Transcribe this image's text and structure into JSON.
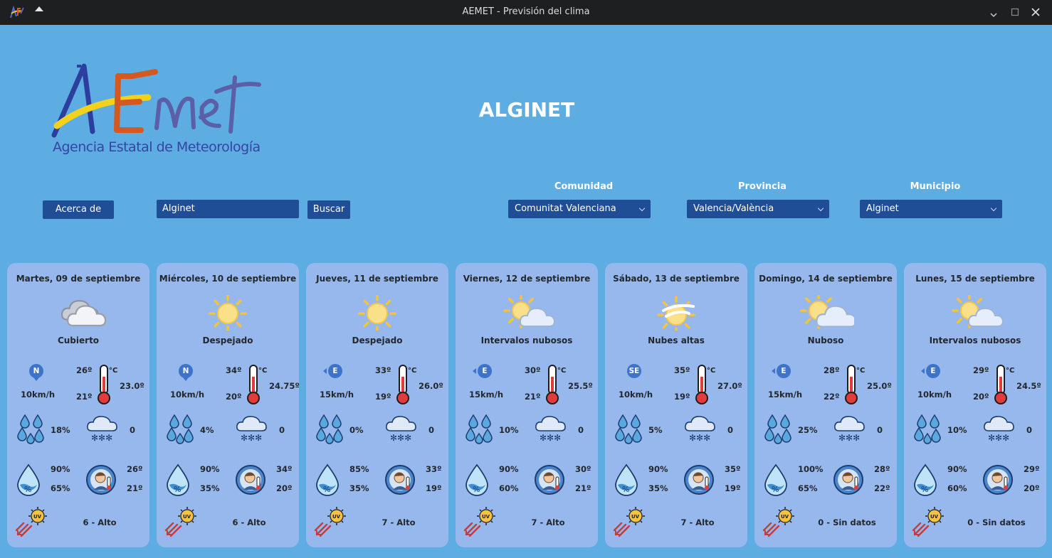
{
  "window": {
    "title": "AEMET - Previsión del clima"
  },
  "logo": {
    "subtitle": "Agencia Estatal de Meteorología"
  },
  "header": {
    "city": "ALGINET"
  },
  "controls": {
    "about_label": "Acerca de",
    "search_value": "Alginet",
    "search_button": "Buscar",
    "comunidad_label": "Comunidad",
    "comunidad_value": "Comunitat Valenciana",
    "provincia_label": "Provincia",
    "provincia_value": "Valencia/València",
    "municipio_label": "Municipio",
    "municipio_value": "Alginet"
  },
  "colors": {
    "background": "#5dade2",
    "card": "#96b8ec",
    "control": "#1f4e96",
    "titlebar": "#1d1f20"
  },
  "days": [
    {
      "date": "Martes, 09 de septiembre",
      "sky_icon": "cloudy-icon",
      "sky": "Cubierto",
      "wind_dir": "N",
      "wind_arrow": "down",
      "wind_speed": "10km/h",
      "t_max": "26º",
      "t_min": "21º",
      "t_avg": "23.0º",
      "rain_prob": "18%",
      "snow": "0",
      "hum_max": "90%",
      "hum_min": "65%",
      "feel_max": "26º",
      "feel_min": "21º",
      "uv": "6 - Alto"
    },
    {
      "date": "Miércoles, 10 de septiembre",
      "sky_icon": "sun-icon",
      "sky": "Despejado",
      "wind_dir": "N",
      "wind_arrow": "down",
      "wind_speed": "10km/h",
      "t_max": "34º",
      "t_min": "20º",
      "t_avg": "24.75º",
      "rain_prob": "4%",
      "snow": "0",
      "hum_max": "90%",
      "hum_min": "35%",
      "feel_max": "34º",
      "feel_min": "20º",
      "uv": "6 - Alto"
    },
    {
      "date": "Jueves, 11 de septiembre",
      "sky_icon": "sun-icon",
      "sky": "Despejado",
      "wind_dir": "E",
      "wind_arrow": "left",
      "wind_speed": "15km/h",
      "t_max": "33º",
      "t_min": "19º",
      "t_avg": "26.0º",
      "rain_prob": "0%",
      "snow": "0",
      "hum_max": "85%",
      "hum_min": "35%",
      "feel_max": "33º",
      "feel_min": "19º",
      "uv": "7 - Alto"
    },
    {
      "date": "Viernes, 12 de septiembre",
      "sky_icon": "sun-cloud-icon",
      "sky": "Intervalos nubosos",
      "wind_dir": "E",
      "wind_arrow": "left",
      "wind_speed": "15km/h",
      "t_max": "30º",
      "t_min": "21º",
      "t_avg": "25.5º",
      "rain_prob": "10%",
      "snow": "0",
      "hum_max": "90%",
      "hum_min": "60%",
      "feel_max": "30º",
      "feel_min": "21º",
      "uv": "7 - Alto"
    },
    {
      "date": "Sábado, 13 de septiembre",
      "sky_icon": "sun-high-clouds-icon",
      "sky": "Nubes altas",
      "wind_dir": "SE",
      "wind_arrow": "none",
      "wind_speed": "10km/h",
      "t_max": "35º",
      "t_min": "19º",
      "t_avg": "27.0º",
      "rain_prob": "5%",
      "snow": "0",
      "hum_max": "90%",
      "hum_min": "35%",
      "feel_max": "35º",
      "feel_min": "19º",
      "uv": "7 - Alto"
    },
    {
      "date": "Domingo, 14 de septiembre",
      "sky_icon": "sun-big-cloud-icon",
      "sky": "Nuboso",
      "wind_dir": "E",
      "wind_arrow": "left",
      "wind_speed": "15km/h",
      "t_max": "28º",
      "t_min": "22º",
      "t_avg": "25.0º",
      "rain_prob": "25%",
      "snow": "0",
      "hum_max": "100%",
      "hum_min": "65%",
      "feel_max": "28º",
      "feel_min": "22º",
      "uv": "0 - Sin datos"
    },
    {
      "date": "Lunes, 15 de septiembre",
      "sky_icon": "sun-cloud-icon",
      "sky": "Intervalos nubosos",
      "wind_dir": "E",
      "wind_arrow": "left",
      "wind_speed": "10km/h",
      "t_max": "29º",
      "t_min": "20º",
      "t_avg": "24.5º",
      "rain_prob": "10%",
      "snow": "0",
      "hum_max": "90%",
      "hum_min": "60%",
      "feel_max": "29º",
      "feel_min": "20º",
      "uv": "0 - Sin datos"
    }
  ]
}
